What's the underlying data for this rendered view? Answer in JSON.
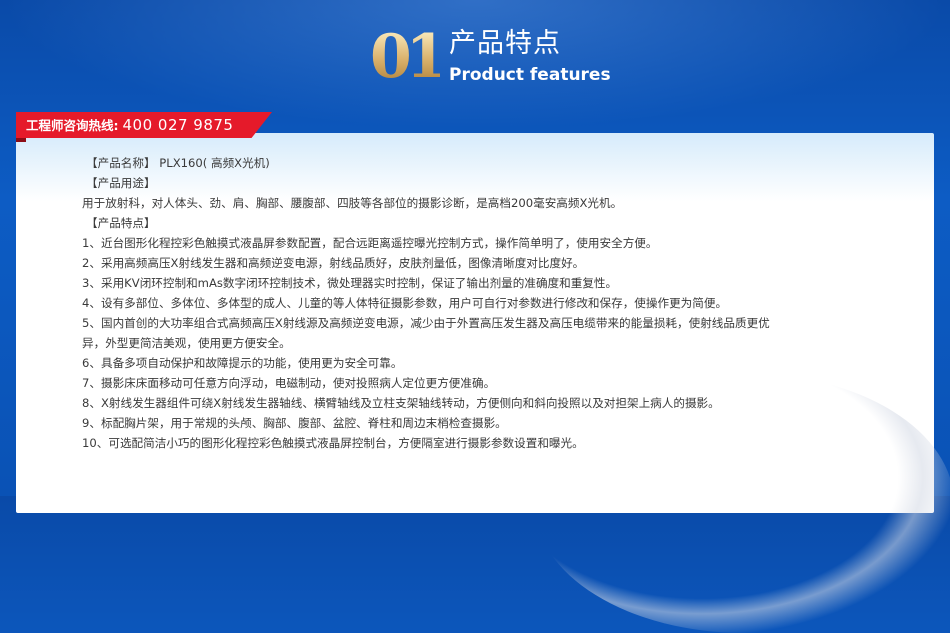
{
  "header": {
    "number": "01",
    "title_zh": "产品特点",
    "title_en": "Product features"
  },
  "hotline": {
    "label": "工程师咨询热线:",
    "phone": "400 027 9875"
  },
  "content": {
    "name_heading": "【产品名称】 PLX160( 高频X光机)",
    "use_heading": "【产品用途】",
    "use_text": "用于放射科，对人体头、劲、肩、胸部、腰腹部、四肢等各部位的摄影诊断，是高档200毫安高频X光机。",
    "features_heading": "【产品特点】",
    "features": [
      "1、近台图形化程控彩色触摸式液晶屏参数配置，配合远距离遥控曝光控制方式，操作简单明了，使用安全方便。",
      "2、采用高频高压X射线发生器和高频逆变电源，射线品质好，皮肤剂量低，图像清晰度对比度好。",
      "3、采用KV闭环控制和mAs数字闭环控制技术，微处理器实时控制，保证了输出剂量的准确度和重复性。",
      "4、设有多部位、多体位、多体型的成人、儿童的等人体特征摄影参数，用户可自行对参数进行修改和保存，使操作更为简便。",
      "5、国内首创的大功率组合式高频高压X射线源及高频逆变电源，减少由于外置高压发生器及高压电缆带来的能量损耗，使射线品质更优异，外型更简洁美观，使用更方便安全。",
      "6、具备多项自动保护和故障提示的功能，使用更为安全可靠。",
      "7、摄影床床面移动可任意方向浮动，电磁制动，使对投照病人定位更方便准确。",
      "8、X射线发生器组件可绕X射线发生器轴线、横臂轴线及立柱支架轴线转动，方便侧向和斜向投照以及对担架上病人的摄影。",
      "9、标配胸片架，用于常规的头颅、胸部、腹部、盆腔、脊柱和周边末梢检查摄影。",
      "10、可选配简洁小巧的图形化程控彩色触摸式液晶屏控制台，方便隔室进行摄影参数设置和曝光。"
    ]
  }
}
